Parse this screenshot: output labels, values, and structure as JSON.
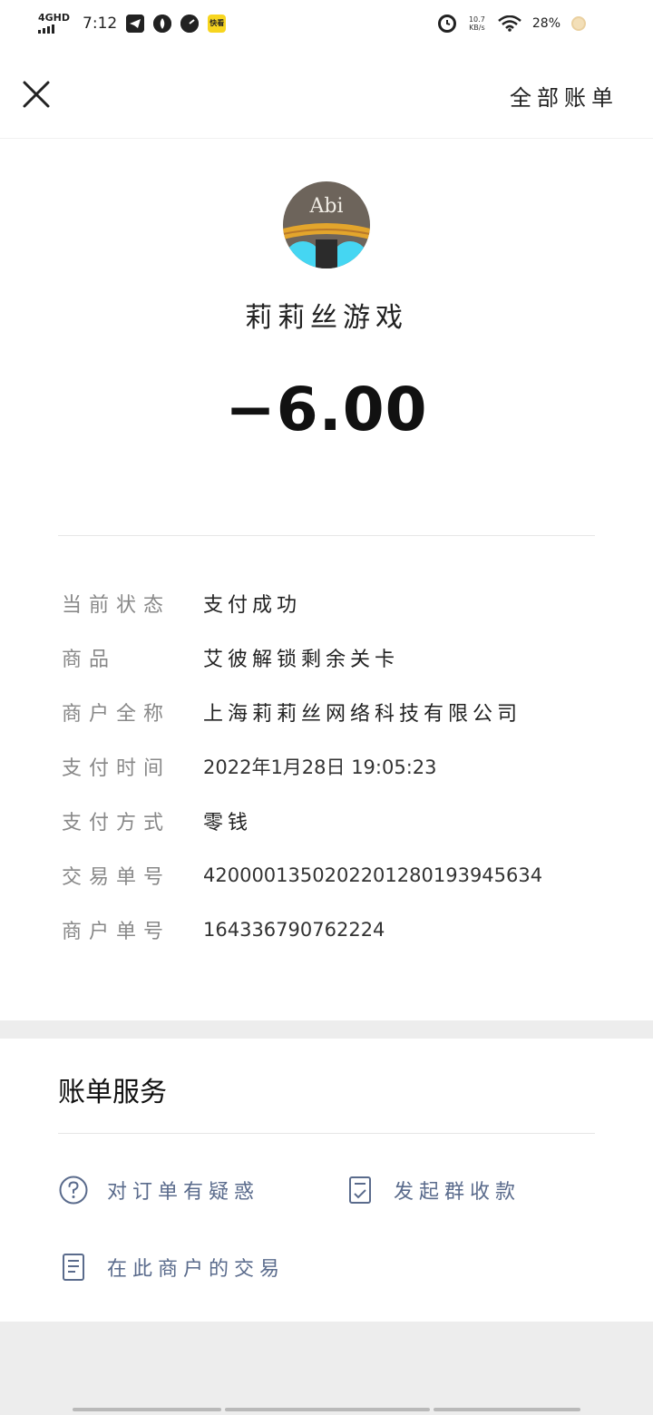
{
  "status_bar": {
    "network": "4GHD",
    "time": "7:12",
    "speed": "10.7 KB/s",
    "battery": "28%",
    "icons": [
      "telegram-icon",
      "app-icon",
      "speedometer-icon",
      "app-badge-icon",
      "alarm-icon",
      "wifi-icon",
      "battery-icon"
    ]
  },
  "header": {
    "close_icon": "close-icon",
    "all_bills_label": "全部账单"
  },
  "transaction": {
    "avatar_text": "Abi",
    "merchant_name": "莉莉丝游戏",
    "amount": "−6.00"
  },
  "details": [
    {
      "label": "当前状态",
      "value": "支付成功"
    },
    {
      "label": "商品",
      "value": "艾彼解锁剩余关卡"
    },
    {
      "label": "商户全称",
      "value": "上海莉莉丝网络科技有限公司"
    },
    {
      "label": "支付时间",
      "value": "2022年1月28日 19:05:23"
    },
    {
      "label": "支付方式",
      "value": "零钱"
    },
    {
      "label": "交易单号",
      "value": "4200001350202201280193945634"
    },
    {
      "label": "商户单号",
      "value": "164336790762224"
    }
  ],
  "services": {
    "title": "账单服务",
    "items": [
      {
        "label": "对订单有疑惑",
        "icon": "question-icon"
      },
      {
        "label": "发起群收款",
        "icon": "document-check-icon"
      },
      {
        "label": "在此商户的交易",
        "icon": "document-icon"
      }
    ]
  },
  "colors": {
    "service_link": "#5a6b8c",
    "label_gray": "#888888",
    "background": "#ededed"
  }
}
